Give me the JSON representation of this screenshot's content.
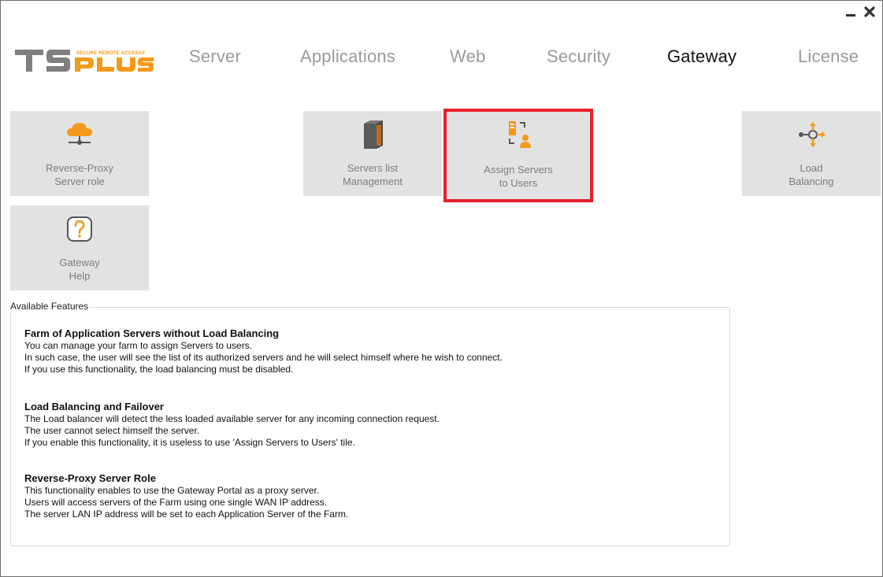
{
  "window": {
    "minimize_symbol": "—",
    "close_symbol": "✖"
  },
  "logo": {
    "brand": "TSPLUS",
    "tagline": "SECURE REMOTE ACCESS®",
    "colors": {
      "ts": "#7f7f7f",
      "plus": "#f39a1c"
    }
  },
  "nav": {
    "tabs": [
      {
        "label": "Server",
        "active": false
      },
      {
        "label": "Applications",
        "active": false
      },
      {
        "label": "Web",
        "active": false
      },
      {
        "label": "Security",
        "active": false
      },
      {
        "label": "Gateway",
        "active": true
      },
      {
        "label": "License",
        "active": false
      }
    ]
  },
  "tiles": [
    {
      "label": "Reverse-Proxy\nServer role",
      "icon": "cloud-network-icon"
    },
    {
      "label": "Servers list\nManagement",
      "icon": "server-tower-icon"
    },
    {
      "label": "Assign Servers\nto Users",
      "icon": "assign-server-user-icon",
      "highlighted": true
    },
    {
      "label": "Load\nBalancing",
      "icon": "load-balancing-icon"
    },
    {
      "label": "Gateway\nHelp",
      "icon": "help-question-icon"
    }
  ],
  "features": {
    "legend": "Available Features",
    "sections": [
      {
        "title": "Farm of Application Servers without Load Balancing",
        "lines": [
          "You can manage your farm to assign Servers to users.",
          "In such case, the user will see the list of its authorized servers and he will select himself where he wish to connect.",
          "If you use this functionality, the load balancing must be disabled."
        ]
      },
      {
        "title": "Load Balancing and Failover",
        "lines": [
          "The Load balancer will detect the less loaded available server for any incoming connection request.",
          "The user cannot select himself the server.",
          "If you enable this functionality, it is useless to use 'Assign  Servers to Users' tile."
        ]
      },
      {
        "title": "Reverse-Proxy Server Role",
        "lines": [
          "This functionality enables to use the Gateway Portal as a proxy server.",
          "Users will access servers of the Farm using one single WAN IP address.",
          "The server LAN IP address will be set to each Application Server of the Farm."
        ]
      }
    ]
  },
  "colors": {
    "accent_orange": "#f39a1c",
    "highlight_red": "#e8202a",
    "tile_bg": "#e2e2e2",
    "nav_inactive": "#9a9a9a",
    "nav_active": "#111111"
  }
}
